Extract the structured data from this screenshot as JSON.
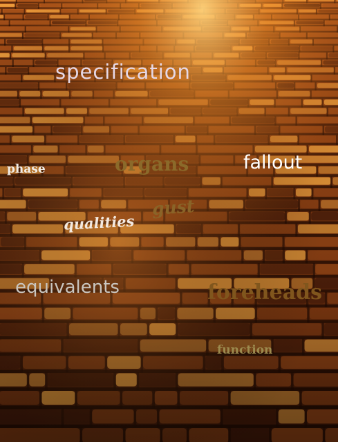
{
  "scene": {
    "description_colors": {
      "highlight": "#ffb347",
      "brick_mid": "#9a4a18",
      "brick_dark": "#3a1608",
      "gap": "#1e0a03"
    }
  },
  "words": {
    "specification": "specification",
    "phase": "phase",
    "organs": "organs",
    "fallout": "fallout",
    "qualities": "qualities",
    "gust": "gust",
    "equivalents": "equivalents",
    "foreheads": "foreheads",
    "function": "function"
  }
}
